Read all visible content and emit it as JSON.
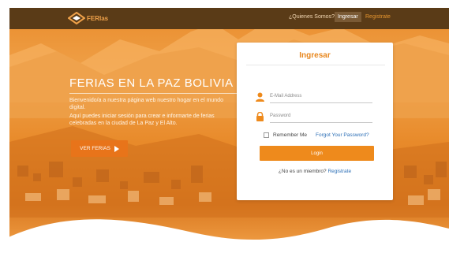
{
  "brand": {
    "name": "FERIas",
    "logo_icon": "diamond-logo-icon",
    "accent": "#e8741a",
    "link_color": "#2c6fb6"
  },
  "nav": {
    "about": "¿Quienes Somos?",
    "login": "Ingresar",
    "register": "Registrate"
  },
  "hero": {
    "title": "FERIAS EN LA PAZ BOLIVIA",
    "desc1": "Bienvenido/a a nuestra página web nuestro hogar en el mundo digital.",
    "desc2": "Aquí puedes iniciar sesión para crear e informarte de ferias celebradas en la ciudad de La Paz y El Alto.",
    "cta": "VER FERIAS"
  },
  "login_form": {
    "title": "Ingresar",
    "email_placeholder": "E-Mail Address",
    "password_placeholder": "Password",
    "remember_label": "Remember Me",
    "forgot_label": "Forgot Your Password?",
    "submit_label": "Login",
    "no_account": "¿No es un miembro?",
    "register_link": "Registrate"
  }
}
